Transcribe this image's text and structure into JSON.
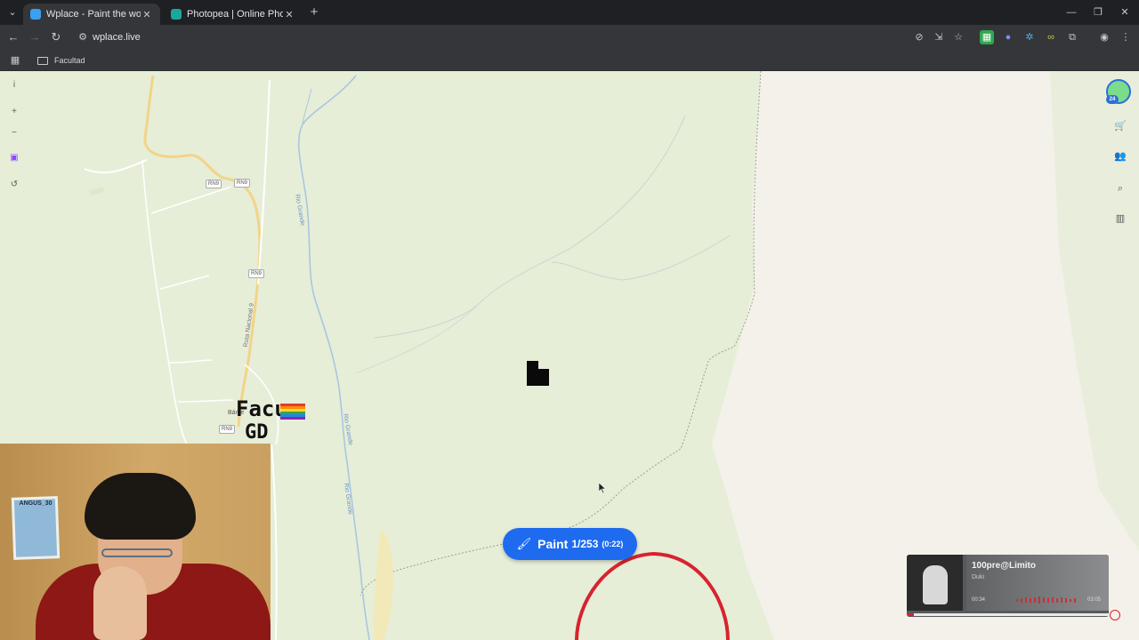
{
  "browser": {
    "tabs": [
      {
        "title": "Wplace - Paint the world",
        "active": true,
        "favicon_color": "#3aa0f0"
      },
      {
        "title": "Photopea | Online Photo Editor",
        "active": false,
        "favicon_color": "#1ba89a"
      }
    ],
    "url": "wplace.live",
    "bookmarks": [
      {
        "label": "Facultad"
      }
    ]
  },
  "map": {
    "road_labels": [
      "RN9",
      "RN9",
      "RN9",
      "RN9"
    ],
    "route_name": "Ruta Nacional 9",
    "river_labels": [
      "Rio Grande",
      "Rio Grande",
      "Rio Grande"
    ],
    "place_label": "Bárce",
    "pixel_art": {
      "line1": "Facu",
      "line2": "GD"
    }
  },
  "toolbar_right": {
    "badge_count": "24"
  },
  "paint_button": {
    "label": "Paint",
    "count": "1/253",
    "timer": "(0:22)"
  },
  "webcam": {
    "poster_text": "ANGUS_30"
  },
  "music": {
    "song": "100pre@Limito",
    "artist": "Duki",
    "elapsed": "00:34",
    "total": "03:05",
    "progress_fraction": 0.035
  },
  "colors": {
    "accent": "#1e6bf0",
    "map_green": "#e6eed8",
    "map_urban": "#f4f1ea",
    "pixel_red": "#d8232f"
  }
}
